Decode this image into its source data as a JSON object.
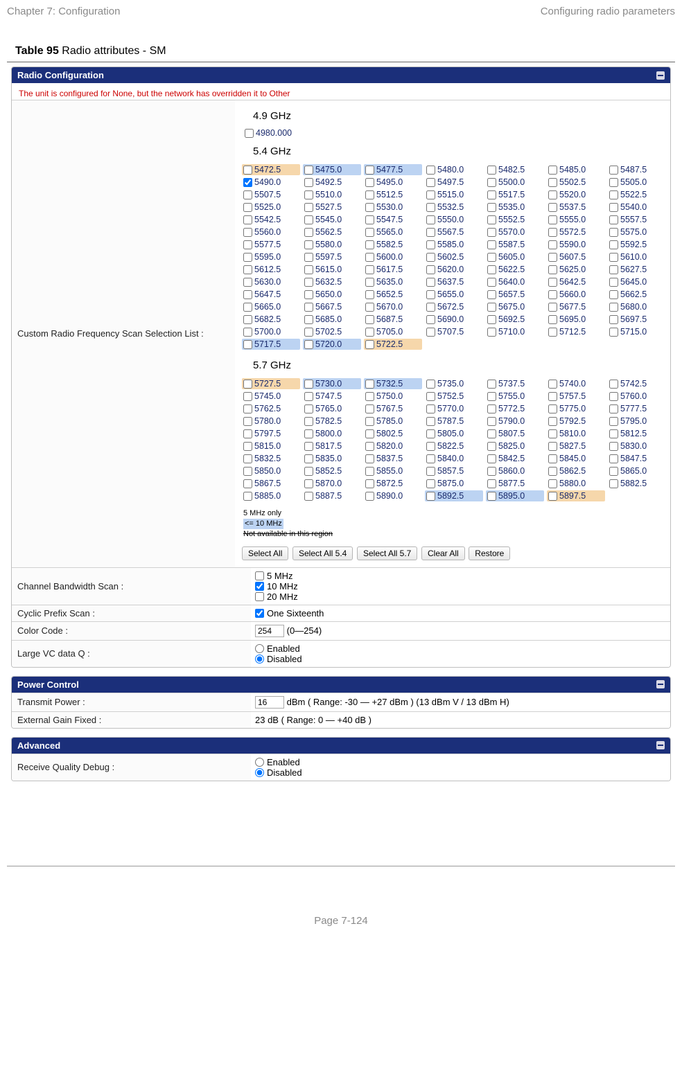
{
  "header": {
    "left": "Chapter 7:  Configuration",
    "right": "Configuring radio parameters"
  },
  "caption": {
    "bold": "Table 95",
    "rest": " Radio attributes - SM"
  },
  "radio": {
    "title": "Radio Configuration",
    "warning": "The unit is configured for None, but the network has overridden it to Other",
    "band49": {
      "title": "4.9 GHz",
      "single": "4980.000"
    },
    "band54": {
      "title": "5.4 GHz",
      "freqs": [
        {
          "v": "5472.5",
          "c": "o"
        },
        {
          "v": "5475.0",
          "c": "b"
        },
        {
          "v": "5477.5",
          "c": "b"
        },
        {
          "v": "5480.0"
        },
        {
          "v": "5482.5"
        },
        {
          "v": "5485.0"
        },
        {
          "v": "5487.5"
        },
        {
          "v": "5490.0",
          "chk": true
        },
        {
          "v": "5492.5"
        },
        {
          "v": "5495.0"
        },
        {
          "v": "5497.5"
        },
        {
          "v": "5500.0"
        },
        {
          "v": "5502.5"
        },
        {
          "v": "5505.0"
        },
        {
          "v": "5507.5"
        },
        {
          "v": "5510.0"
        },
        {
          "v": "5512.5"
        },
        {
          "v": "5515.0"
        },
        {
          "v": "5517.5"
        },
        {
          "v": "5520.0"
        },
        {
          "v": "5522.5"
        },
        {
          "v": "5525.0"
        },
        {
          "v": "5527.5"
        },
        {
          "v": "5530.0"
        },
        {
          "v": "5532.5"
        },
        {
          "v": "5535.0"
        },
        {
          "v": "5537.5"
        },
        {
          "v": "5540.0"
        },
        {
          "v": "5542.5"
        },
        {
          "v": "5545.0"
        },
        {
          "v": "5547.5"
        },
        {
          "v": "5550.0"
        },
        {
          "v": "5552.5"
        },
        {
          "v": "5555.0"
        },
        {
          "v": "5557.5"
        },
        {
          "v": "5560.0"
        },
        {
          "v": "5562.5"
        },
        {
          "v": "5565.0"
        },
        {
          "v": "5567.5"
        },
        {
          "v": "5570.0"
        },
        {
          "v": "5572.5"
        },
        {
          "v": "5575.0"
        },
        {
          "v": "5577.5"
        },
        {
          "v": "5580.0"
        },
        {
          "v": "5582.5"
        },
        {
          "v": "5585.0"
        },
        {
          "v": "5587.5"
        },
        {
          "v": "5590.0"
        },
        {
          "v": "5592.5"
        },
        {
          "v": "5595.0"
        },
        {
          "v": "5597.5"
        },
        {
          "v": "5600.0"
        },
        {
          "v": "5602.5"
        },
        {
          "v": "5605.0"
        },
        {
          "v": "5607.5"
        },
        {
          "v": "5610.0"
        },
        {
          "v": "5612.5"
        },
        {
          "v": "5615.0"
        },
        {
          "v": "5617.5"
        },
        {
          "v": "5620.0"
        },
        {
          "v": "5622.5"
        },
        {
          "v": "5625.0"
        },
        {
          "v": "5627.5"
        },
        {
          "v": "5630.0"
        },
        {
          "v": "5632.5"
        },
        {
          "v": "5635.0"
        },
        {
          "v": "5637.5"
        },
        {
          "v": "5640.0"
        },
        {
          "v": "5642.5"
        },
        {
          "v": "5645.0"
        },
        {
          "v": "5647.5"
        },
        {
          "v": "5650.0"
        },
        {
          "v": "5652.5"
        },
        {
          "v": "5655.0"
        },
        {
          "v": "5657.5"
        },
        {
          "v": "5660.0"
        },
        {
          "v": "5662.5"
        },
        {
          "v": "5665.0"
        },
        {
          "v": "5667.5"
        },
        {
          "v": "5670.0"
        },
        {
          "v": "5672.5"
        },
        {
          "v": "5675.0"
        },
        {
          "v": "5677.5"
        },
        {
          "v": "5680.0"
        },
        {
          "v": "5682.5"
        },
        {
          "v": "5685.0"
        },
        {
          "v": "5687.5"
        },
        {
          "v": "5690.0"
        },
        {
          "v": "5692.5"
        },
        {
          "v": "5695.0"
        },
        {
          "v": "5697.5"
        },
        {
          "v": "5700.0"
        },
        {
          "v": "5702.5"
        },
        {
          "v": "5705.0"
        },
        {
          "v": "5707.5"
        },
        {
          "v": "5710.0"
        },
        {
          "v": "5712.5"
        },
        {
          "v": "5715.0"
        },
        {
          "v": "5717.5",
          "c": "b"
        },
        {
          "v": "5720.0",
          "c": "b"
        },
        {
          "v": "5722.5",
          "c": "o"
        }
      ]
    },
    "band57": {
      "title": "5.7 GHz",
      "freqs": [
        {
          "v": "5727.5",
          "c": "o"
        },
        {
          "v": "5730.0",
          "c": "b"
        },
        {
          "v": "5732.5",
          "c": "b"
        },
        {
          "v": "5735.0"
        },
        {
          "v": "5737.5"
        },
        {
          "v": "5740.0"
        },
        {
          "v": "5742.5"
        },
        {
          "v": "5745.0"
        },
        {
          "v": "5747.5"
        },
        {
          "v": "5750.0"
        },
        {
          "v": "5752.5"
        },
        {
          "v": "5755.0"
        },
        {
          "v": "5757.5"
        },
        {
          "v": "5760.0"
        },
        {
          "v": "5762.5"
        },
        {
          "v": "5765.0"
        },
        {
          "v": "5767.5"
        },
        {
          "v": "5770.0"
        },
        {
          "v": "5772.5"
        },
        {
          "v": "5775.0"
        },
        {
          "v": "5777.5"
        },
        {
          "v": "5780.0"
        },
        {
          "v": "5782.5"
        },
        {
          "v": "5785.0"
        },
        {
          "v": "5787.5"
        },
        {
          "v": "5790.0"
        },
        {
          "v": "5792.5"
        },
        {
          "v": "5795.0"
        },
        {
          "v": "5797.5"
        },
        {
          "v": "5800.0"
        },
        {
          "v": "5802.5"
        },
        {
          "v": "5805.0"
        },
        {
          "v": "5807.5"
        },
        {
          "v": "5810.0"
        },
        {
          "v": "5812.5"
        },
        {
          "v": "5815.0"
        },
        {
          "v": "5817.5"
        },
        {
          "v": "5820.0"
        },
        {
          "v": "5822.5"
        },
        {
          "v": "5825.0"
        },
        {
          "v": "5827.5"
        },
        {
          "v": "5830.0"
        },
        {
          "v": "5832.5"
        },
        {
          "v": "5835.0"
        },
        {
          "v": "5837.5"
        },
        {
          "v": "5840.0"
        },
        {
          "v": "5842.5"
        },
        {
          "v": "5845.0"
        },
        {
          "v": "5847.5"
        },
        {
          "v": "5850.0"
        },
        {
          "v": "5852.5"
        },
        {
          "v": "5855.0"
        },
        {
          "v": "5857.5"
        },
        {
          "v": "5860.0"
        },
        {
          "v": "5862.5"
        },
        {
          "v": "5865.0"
        },
        {
          "v": "5867.5"
        },
        {
          "v": "5870.0"
        },
        {
          "v": "5872.5"
        },
        {
          "v": "5875.0"
        },
        {
          "v": "5877.5"
        },
        {
          "v": "5880.0"
        },
        {
          "v": "5882.5"
        },
        {
          "v": "5885.0"
        },
        {
          "v": "5887.5"
        },
        {
          "v": "5890.0"
        },
        {
          "v": "5892.5",
          "c": "b"
        },
        {
          "v": "5895.0",
          "c": "b"
        },
        {
          "v": "5897.5",
          "c": "o"
        }
      ]
    },
    "legend": {
      "l1": "5 MHz only",
      "l2": "<= 10 MHz",
      "l3": "Not available in this region"
    },
    "buttons": {
      "b1": "Select All",
      "b2": "Select All 5.4",
      "b3": "Select All 5.7",
      "b4": "Clear All",
      "b5": "Restore"
    },
    "scanLabel": "Custom Radio Frequency Scan Selection List :",
    "bw": {
      "label": "Channel Bandwidth Scan :",
      "o1": "5 MHz",
      "o2": "10 MHz",
      "o3": "20 MHz"
    },
    "cp": {
      "label": "Cyclic Prefix Scan :",
      "o1": "One Sixteenth"
    },
    "cc": {
      "label": "Color Code :",
      "val": "254",
      "range": "(0—254)"
    },
    "vcq": {
      "label": "Large VC data Q :",
      "o1": "Enabled",
      "o2": "Disabled"
    }
  },
  "power": {
    "title": "Power Control",
    "tx": {
      "label": "Transmit Power :",
      "val": "16",
      "suffix": "dBm ( Range: -30 — +27 dBm ) (13 dBm V / 13 dBm H)"
    },
    "ext": {
      "label": "External Gain Fixed :",
      "val": "23 dB ( Range: 0 — +40 dB )"
    }
  },
  "adv": {
    "title": "Advanced",
    "rq": {
      "label": "Receive Quality Debug :",
      "o1": "Enabled",
      "o2": "Disabled"
    }
  },
  "footer": "Page 7-124"
}
